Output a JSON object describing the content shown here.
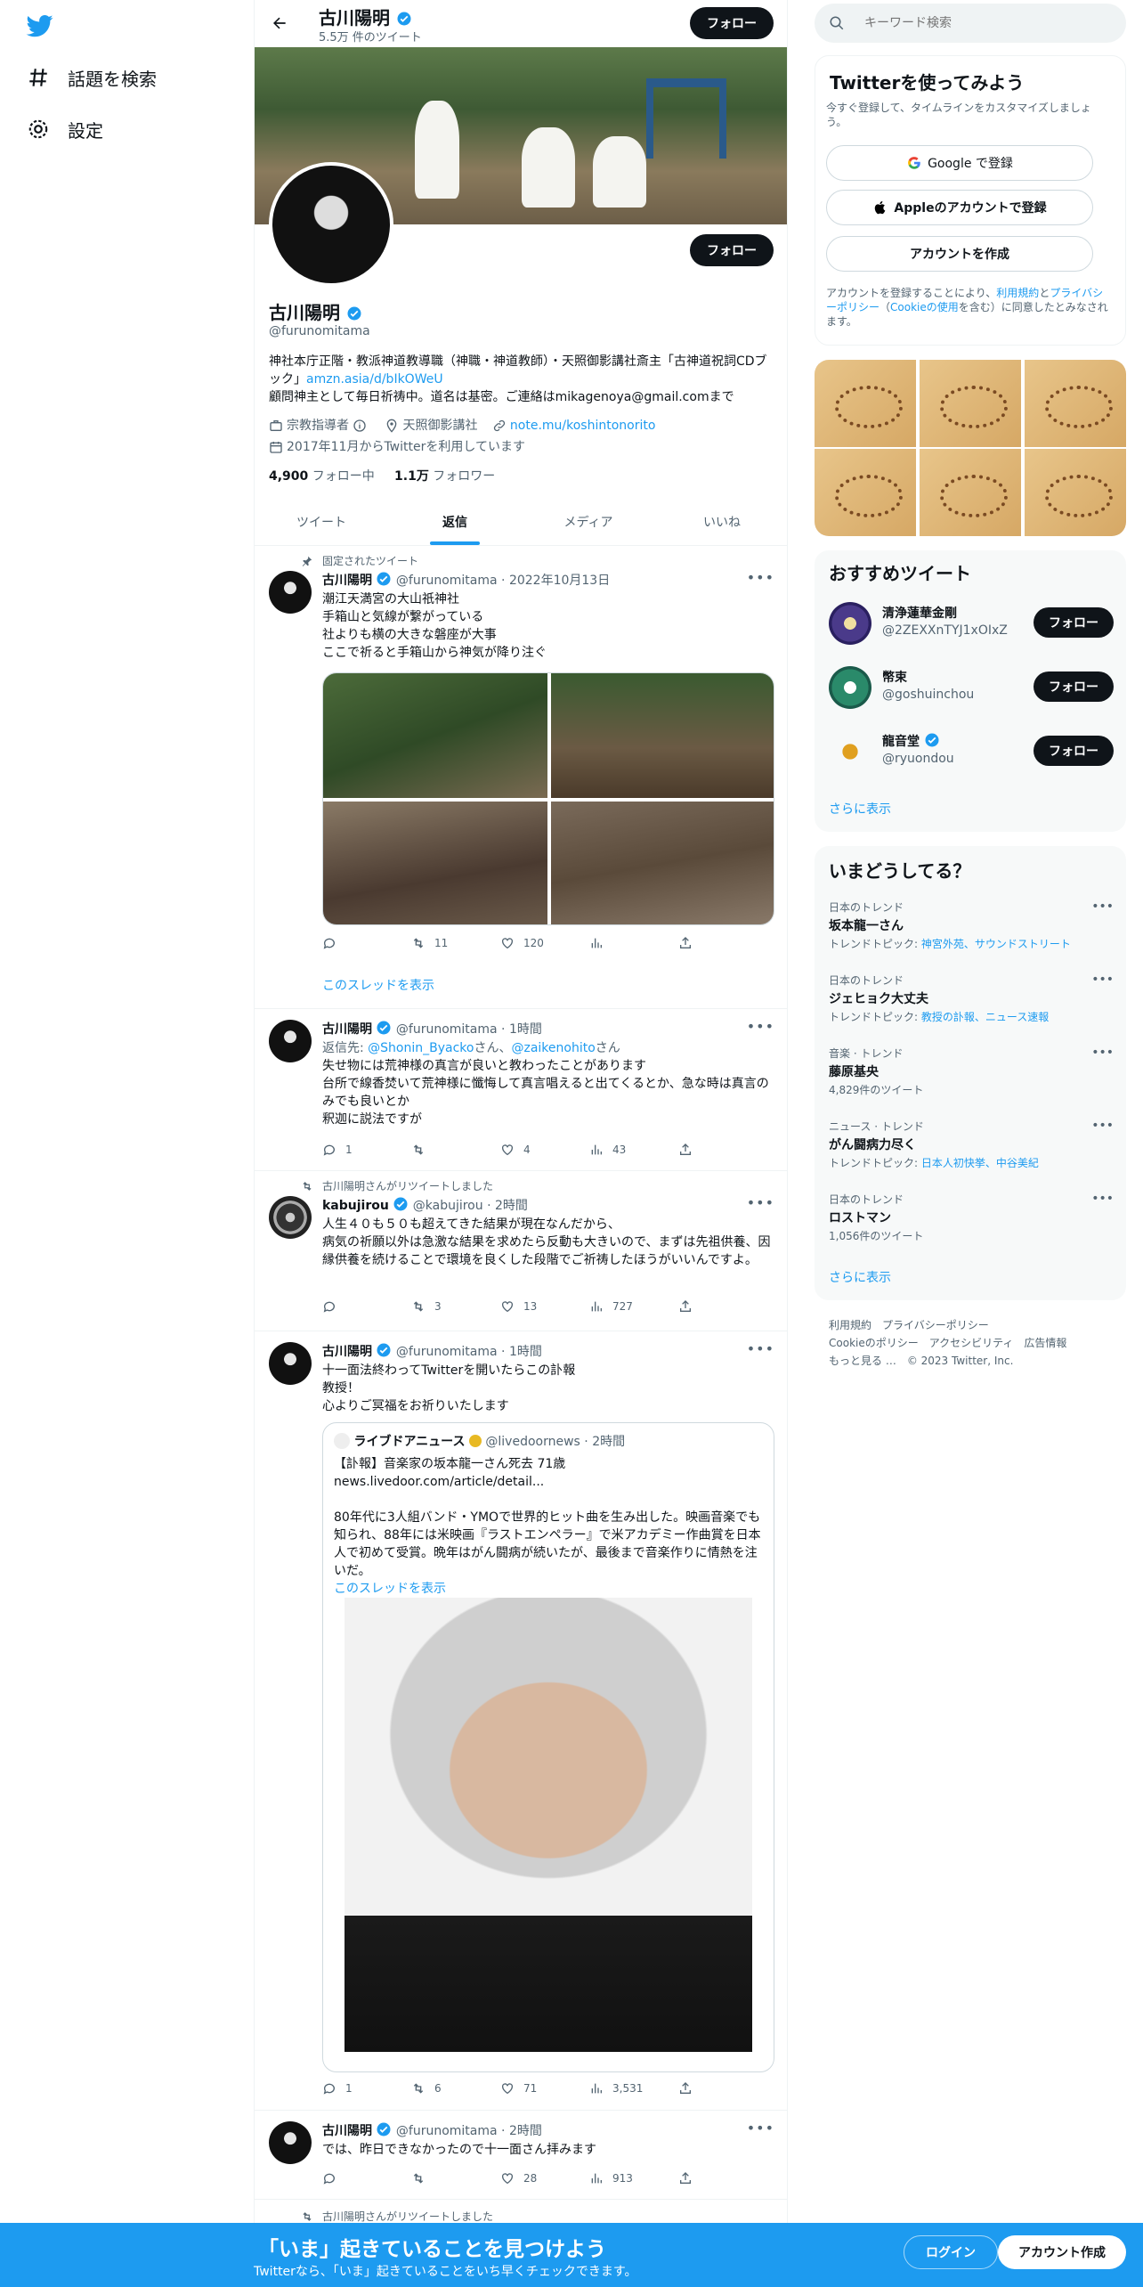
{
  "nav": {
    "explore_label": "話題を検索",
    "settings_label": "設定"
  },
  "header": {
    "name": "古川陽明",
    "tweet_count": "5.5万 件のツイート",
    "follow_label": "フォロー"
  },
  "profile": {
    "name": "古川陽明",
    "handle": "@furunomitama",
    "follow_label": "フォロー",
    "bio_line1": "神社本庁正階・教派神道教導職（神職・神道教師）・天照御影講社斎主「古神道祝詞CDブック」",
    "bio_link": "amzn.asia/d/bIkOWeU",
    "bio_line2": "顧問神主として毎日祈祷中。道名は基密。ご連絡はmikagenoya@gmail.comまで",
    "category": "宗教指導者",
    "location": "天照御影講社",
    "website": "note.mu/koshintonorito",
    "joined": "2017年11月からTwitterを利用しています",
    "following_count": "4,900",
    "following_label": "フォロー中",
    "followers_count": "1.1万",
    "followers_label": "フォロワー"
  },
  "tabs": [
    {
      "label": "ツイート"
    },
    {
      "label": "返信"
    },
    {
      "label": "メディア"
    },
    {
      "label": "いいね"
    }
  ],
  "tweets": [
    {
      "social": "固定されたツイート",
      "name": "古川陽明",
      "handle": "@furunomitama",
      "time": "2022年10月13日",
      "lines": [
        "潮江天満宮の大山祇神社",
        "手箱山と気線が繋がっている",
        "社よりも横の大きな磐座が大事",
        "ここで祈ると手箱山から神気が降り注ぐ"
      ],
      "reply": "",
      "retweet": "11",
      "like": "120",
      "views": "",
      "thread": "このスレッドを表示"
    },
    {
      "name": "古川陽明",
      "handle": "@furunomitama",
      "time": "1時間",
      "reply_to_prefix": "返信先: ",
      "reply_to_1": "@Shonin_Byacko",
      "reply_to_sep": "さん、",
      "reply_to_2": "@zaikenohito",
      "reply_to_suffix": "さん",
      "lines": [
        "失せ物には荒神様の真言が良いと教わったことがあります",
        "台所で線香焚いて荒神様に懺悔して真言唱えると出てくるとか、急な時は真言のみでも良いとか",
        "釈迦に説法ですが"
      ],
      "reply": "1",
      "retweet": "",
      "like": "4",
      "views": "43"
    },
    {
      "social": "古川陽明さんがリツイートしました",
      "name": "kabujirou",
      "handle": "@kabujirou",
      "time": "2時間",
      "lines": [
        "人生４０も５０も超えてきた結果が現在なんだから、",
        "病気の祈願以外は急激な結果を求めたら反動も大きいので、まずは先祖供養、因縁供養を続けることで環境を良くした段階でご祈祷したほうがいいんですよ。"
      ],
      "reply": "",
      "retweet": "3",
      "like": "13",
      "views": "727"
    },
    {
      "name": "古川陽明",
      "handle": "@furunomitama",
      "time": "1時間",
      "lines": [
        "十一面法終わってTwitterを開いたらこの訃報",
        "教授！",
        "心よりご冥福をお祈りいたします"
      ],
      "quote": {
        "name": "ライブドアニュース",
        "handle": "@livedoornews",
        "time": "2時間",
        "headline": "【訃報】音楽家の坂本龍一さん死去 71歳",
        "link": "news.livedoor.com/article/detail...",
        "body": "80年代に3人組バンド・YMOで世界的ヒット曲を生み出した。映画音楽でも知られ、88年には米映画『ラストエンペラー』で米アカデミー作曲賞を日本人で初めて受賞。晩年はがん闘病が続いたが、最後まで音楽作りに情熱を注いだ。",
        "thread": "このスレッドを表示"
      },
      "reply": "1",
      "retweet": "6",
      "like": "71",
      "views": "3,531"
    },
    {
      "name": "古川陽明",
      "handle": "@furunomitama",
      "time": "2時間",
      "lines": [
        "では、昨日できなかったので十一面さん拝みます"
      ],
      "reply": "",
      "retweet": "",
      "like": "28",
      "views": "913"
    },
    {
      "social": "古川陽明さんがリツイートしました"
    }
  ],
  "right": {
    "search_placeholder": "キーワード検索",
    "signup": {
      "title": "Twitterを使ってみよう",
      "subtitle": "今すぐ登録して、タイムラインをカスタマイズしましょう。",
      "google": "Google で登録",
      "apple": "Appleのアカウントで登録",
      "create": "アカウントを作成",
      "legal_1": "アカウントを登録することにより、",
      "legal_terms": "利用規約",
      "legal_2": "と",
      "legal_privacy": "プライバシーポリシー",
      "legal_3": "（",
      "legal_cookie": "Cookieの使用",
      "legal_4": "を含む）に同意したとみなされます。"
    },
    "recommend": {
      "title": "おすすめツイート",
      "users": [
        {
          "name": "清浄蓮華金剛",
          "handle": "@2ZEXXnTYJ1xOIxZ"
        },
        {
          "name": "幣束",
          "handle": "@goshuinchou"
        },
        {
          "name": "龍音堂",
          "handle": "@ryuondou"
        }
      ],
      "follow_label": "フォロー",
      "more": "さらに表示"
    },
    "trends": {
      "title": "いまどうしてる？",
      "items": [
        {
          "cat": "日本のトレンド",
          "name": "坂本龍一さん",
          "sub_prefix": "トレンドトピック: ",
          "sub_links": "神宮外苑、サウンドストリート"
        },
        {
          "cat": "日本のトレンド",
          "name": "ジェヒョク大丈夫",
          "sub_prefix": "トレンドトピック: ",
          "sub_links": "教授の訃報、ニュース速報"
        },
        {
          "cat": "音楽 · トレンド",
          "name": "藤原基央",
          "sub_prefix": "4,829件のツイート",
          "sub_links": ""
        },
        {
          "cat": "ニュース · トレンド",
          "name": "がん闘病力尽く",
          "sub_prefix": "トレンドトピック: ",
          "sub_links": "日本人初快挙、中谷美紀"
        },
        {
          "cat": "日本のトレンド",
          "name": "ロストマン",
          "sub_prefix": "1,056件のツイート",
          "sub_links": ""
        }
      ],
      "more": "さらに表示"
    },
    "footer": {
      "terms": "利用規約",
      "privacy": "プライバシーポリシー",
      "cookie": "Cookieのポリシー",
      "accessibility": "アクセシビリティ",
      "ads": "広告情報",
      "more": "もっと見る …",
      "copyright": "© 2023 Twitter, Inc."
    }
  },
  "bottombar": {
    "title": "「いま」起きていることを見つけよう",
    "subtitle": "Twitterなら、「いま」起きていることをいち早くチェックできます。",
    "login": "ログイン",
    "signup": "アカウント作成"
  },
  "colors": {
    "accent": "#1d9bf0",
    "text": "#0f1419",
    "muted": "#536471"
  }
}
